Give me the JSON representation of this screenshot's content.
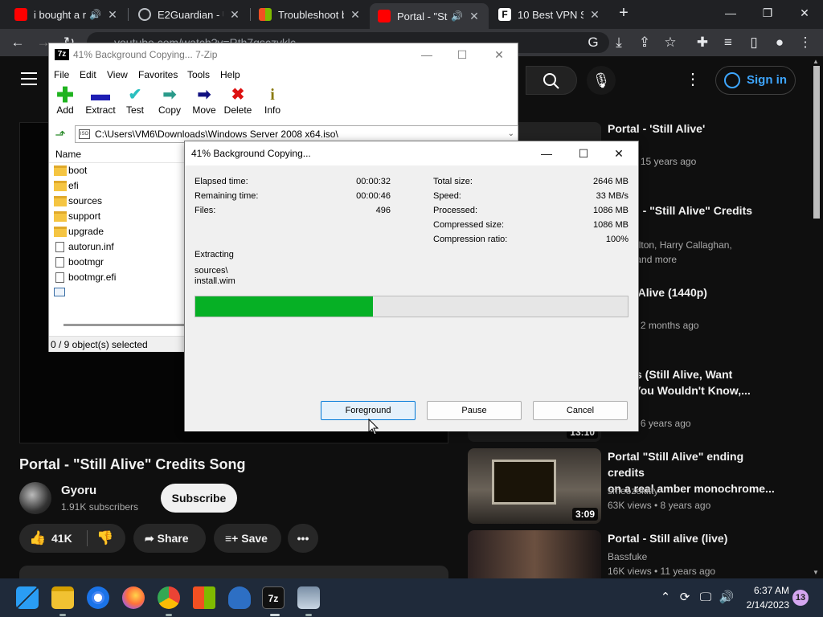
{
  "browser": {
    "tabs": [
      {
        "title": "i bought a r",
        "sound": "🔊"
      },
      {
        "title": "E2Guardian - U"
      },
      {
        "title": "Troubleshoot bl"
      },
      {
        "title": "Portal - \"Stil",
        "sound": "🔊"
      },
      {
        "title": "10 Best VPN Ser"
      }
    ],
    "url": "youtube.com/watch?v=Rth7qsczyklc"
  },
  "youtube": {
    "signin_label": "Sign in",
    "video_title": "Portal - \"Still Alive\" Credits Song",
    "channel_name": "Gyoru",
    "channel_subs": "1.91K subscribers",
    "subscribe_label": "Subscribe",
    "like_count": "41K",
    "share_label": "Share",
    "save_label": "Save",
    "recommendations": [
      {
        "title": "Portal - 'Still Alive'",
        "meta1": "",
        "meta2": "views • 15 years ago",
        "duration": ""
      },
      {
        "title": "Portal - \"Still Alive\" Credits",
        "meta1": "an Coulton, Harry Callaghan,",
        "meta2": "cLain, and more",
        "duration": ""
      },
      {
        "title": "- Still Alive (1440p)",
        "meta1": "o",
        "meta2": "views • 2 months ago",
        "duration": ""
      },
      {
        "title": "Songs (Still Alive, Want\none, You Wouldn't Know,...",
        "meta1": "oodrich",
        "meta2": "views • 6 years ago",
        "duration": "13:10"
      },
      {
        "title": "Portal \"Still Alive\" ending credits\non a real amber monochrome...",
        "meta1": "smeezekitty",
        "meta2": "63K views • 8 years ago",
        "duration": "3:09"
      },
      {
        "title": "Portal - Still alive (live)",
        "meta1": "Bassfuke",
        "meta2": "16K views • 11 years ago",
        "duration": ""
      }
    ]
  },
  "zip": {
    "title": "41% Background Copying... 7-Zip",
    "menu": [
      "File",
      "Edit",
      "View",
      "Favorites",
      "Tools",
      "Help"
    ],
    "toolbar": [
      "Add",
      "Extract",
      "Test",
      "Copy",
      "Move",
      "Delete",
      "Info"
    ],
    "path": "C:\\Users\\VM6\\Downloads\\Windows Server 2008 x64.iso\\",
    "column_name": "Name",
    "files": [
      {
        "name": "boot",
        "type": "folder"
      },
      {
        "name": "efi",
        "type": "folder"
      },
      {
        "name": "sources",
        "type": "folder"
      },
      {
        "name": "support",
        "type": "folder"
      },
      {
        "name": "upgrade",
        "type": "folder"
      },
      {
        "name": "autorun.inf",
        "type": "file"
      },
      {
        "name": "bootmgr",
        "type": "file"
      },
      {
        "name": "bootmgr.efi",
        "type": "file"
      }
    ],
    "status": "0 / 9 object(s) selected"
  },
  "dialog": {
    "title": "41% Background Copying...",
    "elapsed_label": "Elapsed time:",
    "elapsed": "00:00:32",
    "remaining_label": "Remaining time:",
    "remaining": "00:00:46",
    "files_label": "Files:",
    "files": "496",
    "total_label": "Total size:",
    "total": "2646 MB",
    "speed_label": "Speed:",
    "speed": "33 MB/s",
    "processed_label": "Processed:",
    "processed": "1086 MB",
    "compressed_label": "Compressed size:",
    "compressed": "1086 MB",
    "ratio_label": "Compression ratio:",
    "ratio": "100%",
    "operation": "Extracting",
    "current_dir": "sources\\",
    "current_file": "install.wim",
    "progress_percent": 41,
    "btn_foreground": "Foreground",
    "btn_pause": "Pause",
    "btn_cancel": "Cancel"
  },
  "taskbar": {
    "time": "6:37 AM",
    "date": "2/14/2023",
    "notifications": "13"
  }
}
